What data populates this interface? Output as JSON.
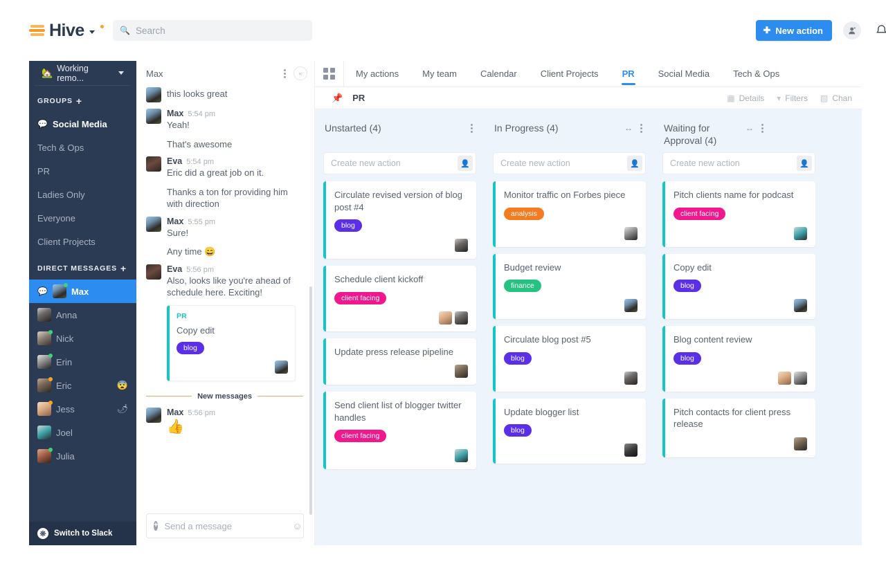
{
  "brand": {
    "name": "Hive",
    "accent": "#2d8cf0",
    "logo_dot_color": "#f5a623",
    "teal": "#16c6c6"
  },
  "topbar": {
    "search_placeholder": "Search",
    "search_value": "",
    "search_icon": "search-icon",
    "new_action_label": "New action",
    "add_person_icon": "add-person-icon",
    "bell_icon": "bell-icon"
  },
  "sidebar": {
    "workspace": {
      "label": "Working remo...",
      "emoji": "🏡"
    },
    "groups_header": "GROUPS",
    "groups_add": "+",
    "groups": [
      {
        "label": "Social Media",
        "active": true
      },
      {
        "label": "Tech & Ops",
        "active": false
      },
      {
        "label": "PR",
        "active": false
      },
      {
        "label": "Ladies Only",
        "active": false
      },
      {
        "label": "Everyone",
        "active": false
      },
      {
        "label": "Client Projects",
        "active": false
      }
    ],
    "dm_header": "DIRECT MESSAGES",
    "dm_add": "+",
    "dms": [
      {
        "name": "Max",
        "status": "online",
        "selected": true,
        "emoji": ""
      },
      {
        "name": "Anna",
        "status": "",
        "selected": false,
        "emoji": ""
      },
      {
        "name": "Nick",
        "status": "online",
        "selected": false,
        "emoji": ""
      },
      {
        "name": "Erin",
        "status": "online",
        "selected": false,
        "emoji": ""
      },
      {
        "name": "Eric",
        "status": "away",
        "selected": false,
        "emoji": "😨"
      },
      {
        "name": "Jess",
        "status": "away",
        "selected": false,
        "emoji": "🌶"
      },
      {
        "name": "Joel",
        "status": "",
        "selected": false,
        "emoji": ""
      },
      {
        "name": "Julia",
        "status": "online",
        "selected": false,
        "emoji": ""
      }
    ],
    "switch_slack_label": "Switch to Slack"
  },
  "chat": {
    "header_title": "Max",
    "menu_icon": "kebab-menu-icon",
    "collapse_icon": "collapse-left-icon",
    "messages": [
      {
        "type": "cont",
        "text": "this looks great",
        "avatar": "av-max",
        "has_avatar": true
      },
      {
        "type": "head",
        "name": "Max",
        "time": "5:54 pm",
        "text": "Yeah!",
        "avatar": "av-max"
      },
      {
        "type": "cont",
        "text": "That's awesome"
      },
      {
        "type": "head",
        "name": "Eva",
        "time": "5:54 pm",
        "text": "Eric did a great job on it.",
        "avatar": "av-eva"
      },
      {
        "type": "cont",
        "text": "Thanks a ton for providing him with direction"
      },
      {
        "type": "head",
        "name": "Max",
        "time": "5:55 pm",
        "text": "Sure!",
        "avatar": "av-max"
      },
      {
        "type": "cont",
        "text": "Any time 😄"
      },
      {
        "type": "head",
        "name": "Eva",
        "time": "5:56 pm",
        "text": "Also, looks like you're ahead of schedule here. Exciting!",
        "avatar": "av-eva"
      }
    ],
    "attached_card": {
      "project": "PR",
      "title": "Copy edit",
      "tag": "blog",
      "tag_class": "blog",
      "avatar": "av-max"
    },
    "new_messages_label": "New messages",
    "last_message": {
      "name": "Max",
      "time": "5:56 pm",
      "text": "👍",
      "avatar": "av-max"
    },
    "composer_placeholder": "Send a message",
    "composer_value": "",
    "add_icon": "add-attachment-icon",
    "emoji_icon": "emoji-icon"
  },
  "main": {
    "grid_icon": "grid-view-icon",
    "tabs": [
      {
        "label": "My actions",
        "active": false
      },
      {
        "label": "My team",
        "active": false
      },
      {
        "label": "Calendar",
        "active": false
      },
      {
        "label": "Client Projects",
        "active": false
      },
      {
        "label": "PR",
        "active": true
      },
      {
        "label": "Social Media",
        "active": false
      },
      {
        "label": "Tech & Ops",
        "active": false
      }
    ],
    "subbar": {
      "pin_icon": "pin-icon",
      "board_name": "PR",
      "actions": [
        {
          "label": "Details",
          "icon": "details-icon"
        },
        {
          "label": "Filters",
          "icon": "filter-icon"
        },
        {
          "label": "Chan",
          "icon": "change-view-icon"
        }
      ]
    },
    "new_action_placeholder": "Create new action",
    "assign_icon": "assign-person-icon",
    "resize_icon": "resize-column-icon",
    "column_menu_icon": "column-menu-icon",
    "columns": [
      {
        "title": "Unstarted (4)",
        "has_resize": false,
        "cards": [
          {
            "title": "Circulate revised version of blog post #4",
            "tag": "blog",
            "tag_class": "blog",
            "avatars": [
              "av-anna"
            ]
          },
          {
            "title": "Schedule client kickoff",
            "tag": "client facing",
            "tag_class": "client",
            "avatars": [
              "av-jess",
              "av-anna"
            ]
          },
          {
            "title": "Update press release pipeline",
            "tag": "",
            "tag_class": "",
            "avatars": [
              "av-eric"
            ]
          },
          {
            "title": "Send client list of blogger twitter handles",
            "tag": "client facing",
            "tag_class": "client",
            "avatars": [
              "av-joel"
            ]
          }
        ]
      },
      {
        "title": "In Progress (4)",
        "has_resize": true,
        "cards": [
          {
            "title": "Monitor traffic on Forbes piece",
            "tag": "analysis",
            "tag_class": "analysis",
            "avatars": [
              "av-erin"
            ]
          },
          {
            "title": "Budget review",
            "tag": "finance",
            "tag_class": "finance",
            "avatars": [
              "av-max"
            ]
          },
          {
            "title": "Circulate blog post #5",
            "tag": "blog",
            "tag_class": "blog",
            "avatars": [
              "av-anna"
            ]
          },
          {
            "title": "Update blogger list",
            "tag": "blog",
            "tag_class": "blog",
            "avatars": [
              "av-dark"
            ]
          }
        ]
      },
      {
        "title": "Waiting for Approval (4)",
        "has_resize": true,
        "cards": [
          {
            "title": "Pitch clients name for podcast",
            "tag": "client facing",
            "tag_class": "client",
            "avatars": [
              "av-joel"
            ]
          },
          {
            "title": "Copy edit",
            "tag": "blog",
            "tag_class": "blog",
            "avatars": [
              "av-max"
            ]
          },
          {
            "title": "Blog content review",
            "tag": "blog",
            "tag_class": "blog",
            "avatars": [
              "av-jess",
              "av-erin"
            ]
          },
          {
            "title": "Pitch contacts for client press release",
            "tag": "",
            "tag_class": "",
            "avatars": [
              "av-eric"
            ]
          }
        ]
      }
    ]
  }
}
